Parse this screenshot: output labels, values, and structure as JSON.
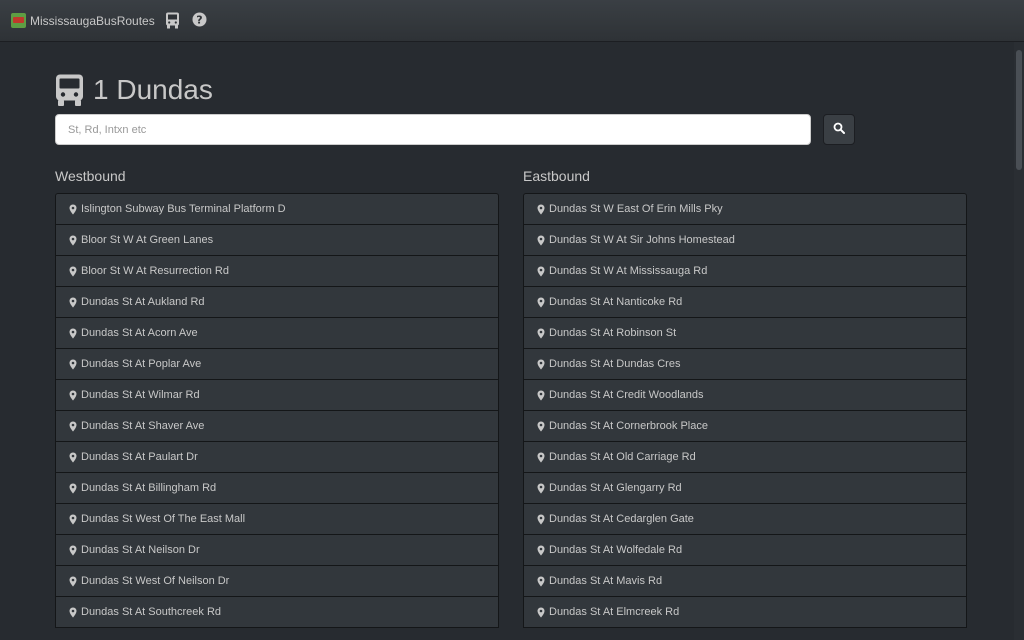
{
  "navbar": {
    "brand": "MississaugaBusRoutes",
    "icons": [
      "bus-icon",
      "help-icon"
    ]
  },
  "page": {
    "title": "1 Dundas",
    "title_icon": "bus-icon"
  },
  "search": {
    "placeholder": "St, Rd, Intxn etc",
    "value": "",
    "button_icon": "search-icon"
  },
  "westbound": {
    "heading": "Westbound",
    "stops": [
      "Islington Subway Bus Terminal Platform D",
      "Bloor St W At Green Lanes",
      "Bloor St W At Resurrection Rd",
      "Dundas St At Aukland Rd",
      "Dundas St At Acorn Ave",
      "Dundas St At Poplar Ave",
      "Dundas St At Wilmar Rd",
      "Dundas St At Shaver Ave",
      "Dundas St At Paulart Dr",
      "Dundas St At Billingham Rd",
      "Dundas St West Of The East Mall",
      "Dundas St At Neilson Dr",
      "Dundas St West Of Neilson Dr",
      "Dundas St At Southcreek Rd"
    ]
  },
  "eastbound": {
    "heading": "Eastbound",
    "stops": [
      "Dundas St W East Of Erin Mills Pky",
      "Dundas St W At Sir Johns Homestead",
      "Dundas St W At Mississauga Rd",
      "Dundas St At Nanticoke Rd",
      "Dundas St At Robinson St",
      "Dundas St At Dundas Cres",
      "Dundas St At Credit Woodlands",
      "Dundas St At Cornerbrook Place",
      "Dundas St At Old Carriage Rd",
      "Dundas St At Glengarry Rd",
      "Dundas St At Cedarglen Gate",
      "Dundas St At Wolfedale Rd",
      "Dundas St At Mavis Rd",
      "Dundas St At Elmcreek Rd"
    ]
  }
}
